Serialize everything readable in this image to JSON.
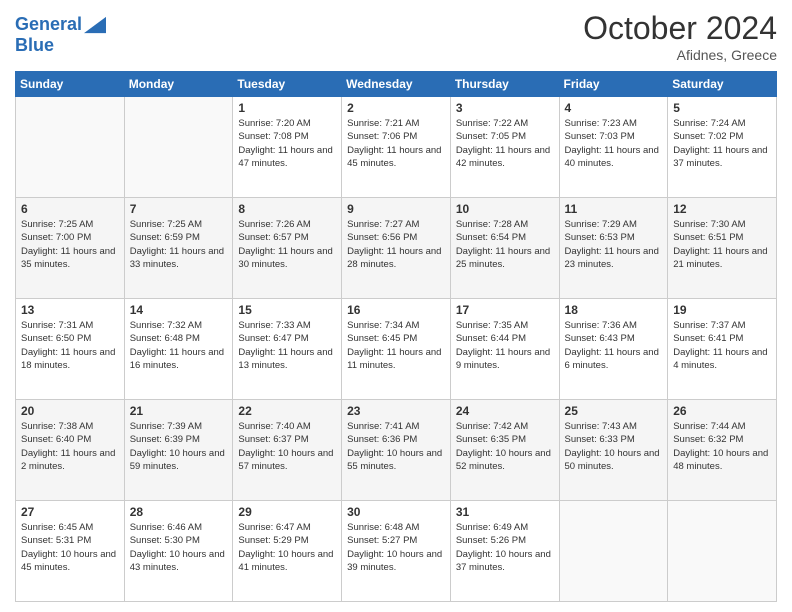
{
  "header": {
    "logo_line1": "General",
    "logo_line2": "Blue",
    "month": "October 2024",
    "location": "Afidnes, Greece"
  },
  "columns": [
    "Sunday",
    "Monday",
    "Tuesday",
    "Wednesday",
    "Thursday",
    "Friday",
    "Saturday"
  ],
  "rows": [
    [
      {
        "num": "",
        "info": ""
      },
      {
        "num": "",
        "info": ""
      },
      {
        "num": "1",
        "info": "Sunrise: 7:20 AM\nSunset: 7:08 PM\nDaylight: 11 hours and 47 minutes."
      },
      {
        "num": "2",
        "info": "Sunrise: 7:21 AM\nSunset: 7:06 PM\nDaylight: 11 hours and 45 minutes."
      },
      {
        "num": "3",
        "info": "Sunrise: 7:22 AM\nSunset: 7:05 PM\nDaylight: 11 hours and 42 minutes."
      },
      {
        "num": "4",
        "info": "Sunrise: 7:23 AM\nSunset: 7:03 PM\nDaylight: 11 hours and 40 minutes."
      },
      {
        "num": "5",
        "info": "Sunrise: 7:24 AM\nSunset: 7:02 PM\nDaylight: 11 hours and 37 minutes."
      }
    ],
    [
      {
        "num": "6",
        "info": "Sunrise: 7:25 AM\nSunset: 7:00 PM\nDaylight: 11 hours and 35 minutes."
      },
      {
        "num": "7",
        "info": "Sunrise: 7:25 AM\nSunset: 6:59 PM\nDaylight: 11 hours and 33 minutes."
      },
      {
        "num": "8",
        "info": "Sunrise: 7:26 AM\nSunset: 6:57 PM\nDaylight: 11 hours and 30 minutes."
      },
      {
        "num": "9",
        "info": "Sunrise: 7:27 AM\nSunset: 6:56 PM\nDaylight: 11 hours and 28 minutes."
      },
      {
        "num": "10",
        "info": "Sunrise: 7:28 AM\nSunset: 6:54 PM\nDaylight: 11 hours and 25 minutes."
      },
      {
        "num": "11",
        "info": "Sunrise: 7:29 AM\nSunset: 6:53 PM\nDaylight: 11 hours and 23 minutes."
      },
      {
        "num": "12",
        "info": "Sunrise: 7:30 AM\nSunset: 6:51 PM\nDaylight: 11 hours and 21 minutes."
      }
    ],
    [
      {
        "num": "13",
        "info": "Sunrise: 7:31 AM\nSunset: 6:50 PM\nDaylight: 11 hours and 18 minutes."
      },
      {
        "num": "14",
        "info": "Sunrise: 7:32 AM\nSunset: 6:48 PM\nDaylight: 11 hours and 16 minutes."
      },
      {
        "num": "15",
        "info": "Sunrise: 7:33 AM\nSunset: 6:47 PM\nDaylight: 11 hours and 13 minutes."
      },
      {
        "num": "16",
        "info": "Sunrise: 7:34 AM\nSunset: 6:45 PM\nDaylight: 11 hours and 11 minutes."
      },
      {
        "num": "17",
        "info": "Sunrise: 7:35 AM\nSunset: 6:44 PM\nDaylight: 11 hours and 9 minutes."
      },
      {
        "num": "18",
        "info": "Sunrise: 7:36 AM\nSunset: 6:43 PM\nDaylight: 11 hours and 6 minutes."
      },
      {
        "num": "19",
        "info": "Sunrise: 7:37 AM\nSunset: 6:41 PM\nDaylight: 11 hours and 4 minutes."
      }
    ],
    [
      {
        "num": "20",
        "info": "Sunrise: 7:38 AM\nSunset: 6:40 PM\nDaylight: 11 hours and 2 minutes."
      },
      {
        "num": "21",
        "info": "Sunrise: 7:39 AM\nSunset: 6:39 PM\nDaylight: 10 hours and 59 minutes."
      },
      {
        "num": "22",
        "info": "Sunrise: 7:40 AM\nSunset: 6:37 PM\nDaylight: 10 hours and 57 minutes."
      },
      {
        "num": "23",
        "info": "Sunrise: 7:41 AM\nSunset: 6:36 PM\nDaylight: 10 hours and 55 minutes."
      },
      {
        "num": "24",
        "info": "Sunrise: 7:42 AM\nSunset: 6:35 PM\nDaylight: 10 hours and 52 minutes."
      },
      {
        "num": "25",
        "info": "Sunrise: 7:43 AM\nSunset: 6:33 PM\nDaylight: 10 hours and 50 minutes."
      },
      {
        "num": "26",
        "info": "Sunrise: 7:44 AM\nSunset: 6:32 PM\nDaylight: 10 hours and 48 minutes."
      }
    ],
    [
      {
        "num": "27",
        "info": "Sunrise: 6:45 AM\nSunset: 5:31 PM\nDaylight: 10 hours and 45 minutes."
      },
      {
        "num": "28",
        "info": "Sunrise: 6:46 AM\nSunset: 5:30 PM\nDaylight: 10 hours and 43 minutes."
      },
      {
        "num": "29",
        "info": "Sunrise: 6:47 AM\nSunset: 5:29 PM\nDaylight: 10 hours and 41 minutes."
      },
      {
        "num": "30",
        "info": "Sunrise: 6:48 AM\nSunset: 5:27 PM\nDaylight: 10 hours and 39 minutes."
      },
      {
        "num": "31",
        "info": "Sunrise: 6:49 AM\nSunset: 5:26 PM\nDaylight: 10 hours and 37 minutes."
      },
      {
        "num": "",
        "info": ""
      },
      {
        "num": "",
        "info": ""
      }
    ]
  ]
}
